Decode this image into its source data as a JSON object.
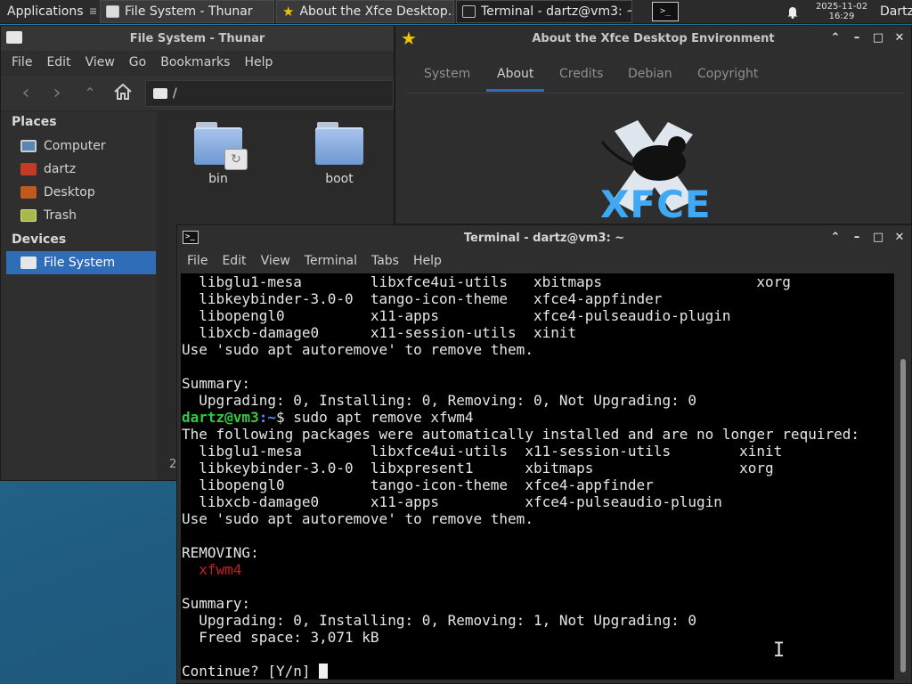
{
  "panel": {
    "applications_label": "Applications",
    "tasks": [
      {
        "label": "File System - Thunar"
      },
      {
        "label": "About the Xfce Desktop..."
      },
      {
        "label": "Terminal - dartz@vm3: ~"
      }
    ],
    "clock_date": "2025-11-02",
    "clock_time": "16:29",
    "user": "Dartz"
  },
  "thunar": {
    "title": "File System - Thunar",
    "menu": [
      "File",
      "Edit",
      "View",
      "Go",
      "Bookmarks",
      "Help"
    ],
    "path": "/",
    "places_header": "Places",
    "places": [
      {
        "label": "Computer",
        "icon": "computer-icon"
      },
      {
        "label": "dartz",
        "icon": "home-icon"
      },
      {
        "label": "Desktop",
        "icon": "desktop-icon"
      },
      {
        "label": "Trash",
        "icon": "trash-icon"
      }
    ],
    "devices_header": "Devices",
    "devices": [
      {
        "label": "File System",
        "icon": "drive-icon"
      }
    ],
    "files": [
      {
        "name": "bin",
        "symlink": true
      },
      {
        "name": "boot",
        "symlink": false
      }
    ],
    "status_fragment": "2"
  },
  "about": {
    "title": "About the Xfce Desktop Environment",
    "tabs": [
      "System",
      "About",
      "Credits",
      "Debian",
      "Copyright"
    ],
    "active_tab": "About",
    "logo_text": "XFCE"
  },
  "terminal": {
    "title": "Terminal - dartz@vm3: ~",
    "menu": [
      "File",
      "Edit",
      "View",
      "Terminal",
      "Tabs",
      "Help"
    ],
    "lines": [
      "  libglu1-mesa        libxfce4ui-utils   xbitmaps                  xorg",
      "  libkeybinder-3.0-0  tango-icon-theme   xfce4-appfinder",
      "  libopengl0          x11-apps           xfce4-pulseaudio-plugin",
      "  libxcb-damage0      x11-session-utils  xinit",
      "Use 'sudo apt autoremove' to remove them.",
      "",
      "Summary:",
      "  Upgrading: 0, Installing: 0, Removing: 0, Not Upgrading: 0"
    ],
    "prompt_user": "dartz@vm3",
    "prompt_path": ":~",
    "prompt_symbol": "$",
    "command": " sudo apt remove xfwm4",
    "lines2": [
      "The following packages were automatically installed and are no longer required:",
      "  libglu1-mesa        libxfce4ui-utils  x11-session-utils        xinit",
      "  libkeybinder-3.0-0  libxpresent1      xbitmaps                 xorg",
      "  libopengl0          tango-icon-theme  xfce4-appfinder",
      "  libxcb-damage0      x11-apps          xfce4-pulseaudio-plugin",
      "Use 'sudo apt autoremove' to remove them.",
      "",
      "REMOVING:"
    ],
    "removing_pkg": "  xfwm4",
    "lines3": [
      "",
      "Summary:",
      "  Upgrading: 0, Installing: 0, Removing: 1, Not Upgrading: 0",
      "  Freed space: 3,071 kB",
      ""
    ],
    "continue_prompt": "Continue? [Y/n] "
  },
  "colors": {
    "selection": "#2f6db8",
    "prompt_user": "#2ecc40",
    "prompt_path": "#5b8cff",
    "removing": "#c81e1e"
  }
}
